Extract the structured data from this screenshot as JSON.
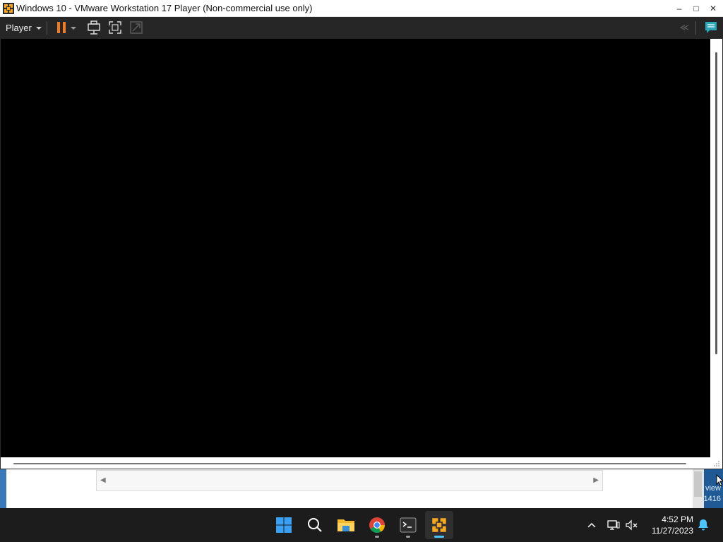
{
  "window": {
    "title": "Windows 10 - VMware Workstation 17 Player (Non-commercial use only)",
    "minimize_glyph": "–",
    "maximize_glyph": "□",
    "close_glyph": "✕"
  },
  "toolbar": {
    "player_menu_label": "Player",
    "icons": [
      "pause-icon",
      "dropdown-caret-icon",
      "send-ctrl-alt-del-icon",
      "fullscreen-icon",
      "unity-icon",
      "collapse-toolbar-icon",
      "message-log-icon"
    ]
  },
  "background_window": {
    "right_strip_lines": [
      "view",
      "1416"
    ]
  },
  "taskbar": {
    "apps": [
      "start-icon",
      "search-icon",
      "file-explorer-icon",
      "chrome-icon",
      "terminal-icon",
      "vmware-icon"
    ],
    "time": "4:52 PM",
    "date": "11/27/2023"
  },
  "colors": {
    "accent": "#4cc2ff",
    "pause_orange": "#f07b22",
    "vmware_orange": "#f5a623"
  }
}
